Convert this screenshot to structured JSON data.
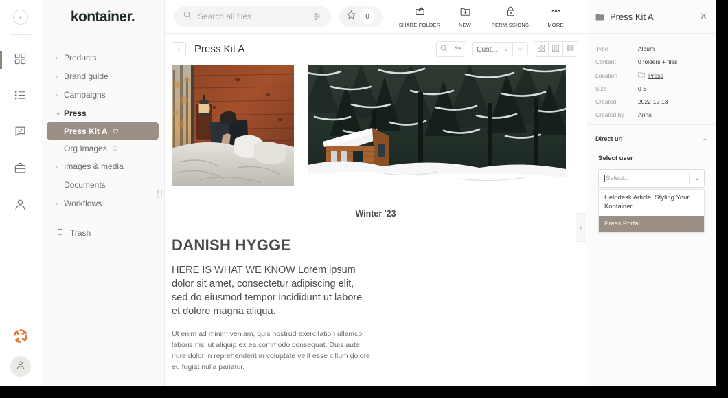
{
  "rail": {
    "collapse_label": "‹",
    "items": [
      {
        "name": "dashboard",
        "icon": "grid-icon",
        "active": true
      },
      {
        "name": "lists",
        "icon": "list-icon",
        "active": false
      },
      {
        "name": "approvals",
        "icon": "chat-check-icon",
        "active": false
      },
      {
        "name": "briefcase",
        "icon": "briefcase-icon",
        "active": false
      },
      {
        "name": "contacts",
        "icon": "person-icon",
        "active": false
      }
    ],
    "help_icon": "lifering-icon",
    "avatar_icon": "user-avatar-icon"
  },
  "sidebar": {
    "logo": "kontainer.",
    "tree": [
      {
        "label": "Products",
        "type": "group",
        "expanded": false
      },
      {
        "label": "Brand guide",
        "type": "group",
        "expanded": false
      },
      {
        "label": "Campaigns",
        "type": "group",
        "expanded": false
      },
      {
        "label": "Press",
        "type": "group",
        "expanded": true
      }
    ],
    "children": [
      {
        "label": "Press Kit A",
        "selected": true,
        "favorite_icon": "heart-icon"
      },
      {
        "label": "Org Images",
        "selected": false,
        "favorite_icon": "heart-icon"
      }
    ],
    "tree_after": [
      {
        "label": "Images & media",
        "type": "group",
        "expanded": false
      }
    ],
    "plain": [
      {
        "label": "Documents"
      }
    ],
    "tree_last": [
      {
        "label": "Workflows",
        "type": "group",
        "expanded": false
      }
    ],
    "trash": {
      "label": "Trash",
      "icon": "trash-icon"
    },
    "chevron_collapsed": "›",
    "chevron_expanded": "⌄"
  },
  "topbar": {
    "search": {
      "value": "",
      "placeholder": "Search all files",
      "icon": "search-icon",
      "filter_icon": "sliders-icon"
    },
    "favorites": {
      "count": "0",
      "icon": "star-icon"
    },
    "actions": [
      {
        "label": "SHARE FOLDER",
        "icon": "share-folder-icon"
      },
      {
        "label": "NEW",
        "icon": "new-folder-icon"
      },
      {
        "label": "PERMISSIONS",
        "icon": "lock-icon"
      },
      {
        "label": "MORE",
        "icon": "more-dots-icon"
      }
    ]
  },
  "content_header": {
    "back_label": "‹",
    "title": "Press Kit A",
    "search_icon": "search-icon",
    "swap_icon": "swap-icon",
    "sort_value": "Cust...",
    "sort_chevron": "⌄",
    "sort_dir_icon": "sort-asc-icon",
    "views": [
      {
        "name": "grid-large-view",
        "icon": "grid-large-icon"
      },
      {
        "name": "grid-small-view",
        "icon": "grid-small-icon"
      },
      {
        "name": "list-view",
        "icon": "list-view-icon"
      }
    ]
  },
  "album": {
    "images": [
      {
        "name": "cabin-bedroom-reading",
        "alt": "Person reading in bed in a wooden cabin with lantern"
      },
      {
        "name": "snowy-forest-cabin",
        "alt": "Small wooden cabin in a snow covered pine forest"
      }
    ],
    "season_label": "Winter '23",
    "panel_tab": "›"
  },
  "document": {
    "heading": "DANISH HYGGE",
    "lead": "HERE IS WHAT WE KNOW\nLorem ipsum dolor sit amet, consectetur adipiscing elit, sed do eiusmod tempor incididunt ut labore et dolore magna aliqua.",
    "body": "Ut enim ad minim veniam, quis nostrud exercitation ullamco laboris nisi ut aliquip ex ea commodo consequat. Duis aute irure dolor in reprehenderit in voluptate velit esse cillum dolore eu fugiat nulla pariatur."
  },
  "info_panel": {
    "title": "Press Kit A",
    "folder_icon": "folder-icon",
    "close_label": "✕",
    "meta": [
      {
        "key": "Type",
        "value": "Album",
        "link": false
      },
      {
        "key": "Content",
        "value": "0 folders + files",
        "link": false
      },
      {
        "key": "Location",
        "value": "Press",
        "link": true,
        "icon": "folder-outline-icon"
      },
      {
        "key": "Size",
        "value": "0 B",
        "link": false
      },
      {
        "key": "Created",
        "value": "2022-12-13",
        "link": false
      },
      {
        "key": "Created by",
        "value": "Anna",
        "link": true
      }
    ],
    "direct_url": {
      "label": "Direct url",
      "chevron": "⌄"
    },
    "select_user": {
      "label": "Select user",
      "placeholder": "Select...",
      "value": "",
      "chevron": "⌄",
      "options": [
        {
          "label": "Helpdesk Article: Styling Your Kontainer",
          "highlighted": false
        },
        {
          "label": "Press Portal",
          "highlighted": true
        }
      ]
    }
  },
  "colors": {
    "accent_taupe": "#9a9086",
    "help_orange": "#e07b39",
    "panel_bg": "#fbfbfb",
    "sidebar_bg": "#fafafa"
  }
}
